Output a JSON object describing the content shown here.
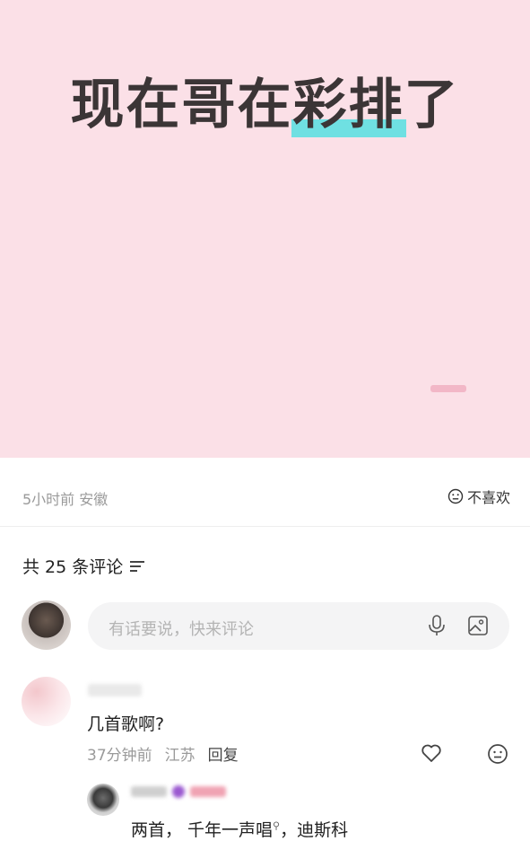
{
  "post": {
    "title_part1": "现在哥在",
    "title_highlight": "彩排",
    "title_part3": "了",
    "time_location": "5小时前 安徽",
    "dislike_label": "不喜欢"
  },
  "comments_section": {
    "count_label": "共 25 条评论",
    "input_placeholder": "有话要说，快来评论"
  },
  "comment": {
    "text": "几首歌啊?",
    "time": "37分钟前",
    "location": "江苏",
    "reply_label": "回复"
  },
  "reply": {
    "text": "两首， 千年一声唱",
    "text_tail": "，迪斯科"
  },
  "colors": {
    "hero_bg": "#fbe0e7",
    "highlight": "#6fe0e2"
  }
}
